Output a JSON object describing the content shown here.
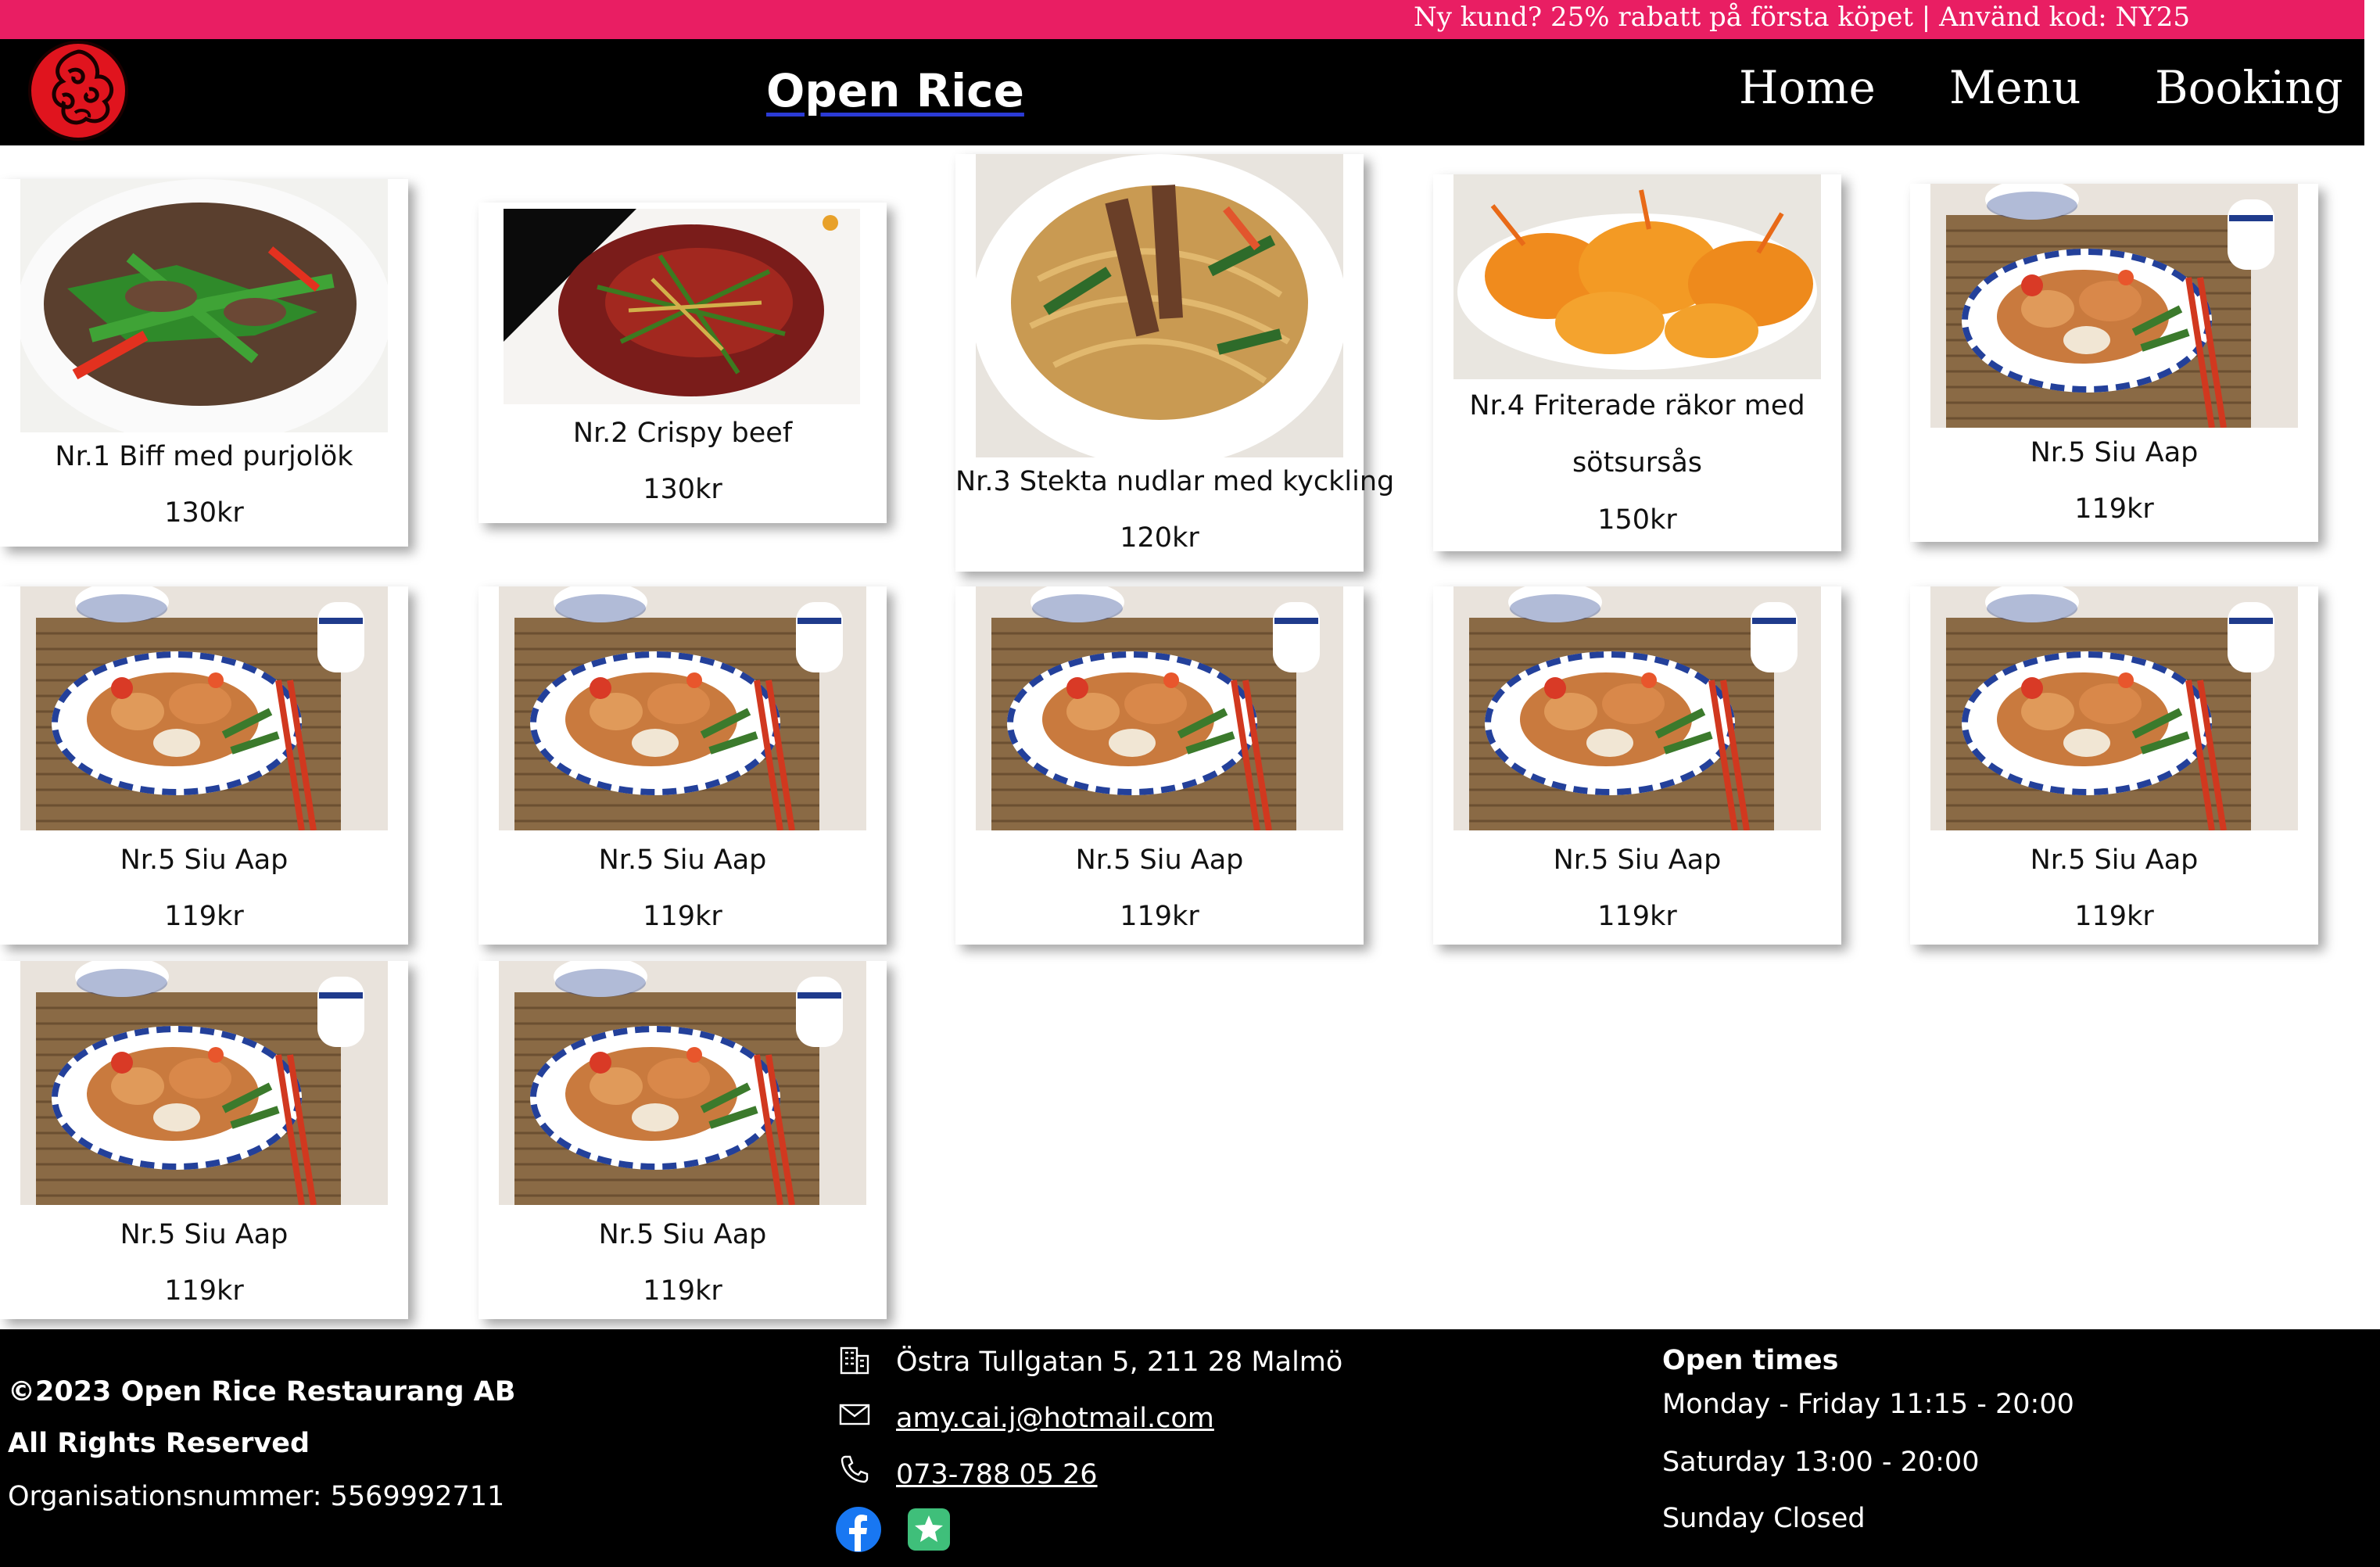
{
  "promo": {
    "text": "Ny kund? 25% rabatt på första köpet | Använd kod: NY25"
  },
  "header": {
    "brand": "Open Rice",
    "nav": [
      "Home",
      "Menu",
      "Booking"
    ]
  },
  "menu": {
    "items": [
      {
        "name": "Nr.1 Biff med purjolök",
        "price": "130kr",
        "image": "beef-leek-dish"
      },
      {
        "name": "Nr.2 Crispy beef",
        "price": "130kr",
        "image": "crispy-beef-dish"
      },
      {
        "name": "Nr.3 Stekta nudlar med kyckling",
        "price": "120kr",
        "image": "fried-noodles-chicken-dish"
      },
      {
        "name_line1": "Nr.4 Friterade räkor med",
        "name_line2": "sötsursås",
        "price": "150kr",
        "image": "fried-shrimp-dish"
      },
      {
        "name": "Nr.5 Siu Aap",
        "price": "119kr",
        "image": "siu-aap-plate"
      },
      {
        "name": "Nr.5 Siu Aap",
        "price": "119kr",
        "image": "siu-aap-plate"
      },
      {
        "name": "Nr.5 Siu Aap",
        "price": "119kr",
        "image": "siu-aap-plate"
      },
      {
        "name": "Nr.5 Siu Aap",
        "price": "119kr",
        "image": "siu-aap-plate"
      },
      {
        "name": "Nr.5 Siu Aap",
        "price": "119kr",
        "image": "siu-aap-plate"
      },
      {
        "name": "Nr.5 Siu Aap",
        "price": "119kr",
        "image": "siu-aap-plate"
      },
      {
        "name": "Nr.5 Siu Aap",
        "price": "119kr",
        "image": "siu-aap-plate"
      },
      {
        "name": "Nr.5 Siu Aap",
        "price": "119kr",
        "image": "siu-aap-plate"
      }
    ]
  },
  "footer": {
    "copyright": "©2023 Open Rice Restaurang AB",
    "rights": "All Rights Reserved",
    "org": "Organisationsnummer: 5569992711",
    "address": "Östra Tullgatan 5, 211 28 Malmö",
    "email": "amy.cai.j@hotmail.com",
    "phone": "073-788 05 26",
    "hours_title": "Open times",
    "hours": [
      "Monday - Friday 11:15 - 20:00",
      "Saturday 13:00 - 20:00",
      "Sunday Closed"
    ],
    "icons": [
      "building-icon",
      "mail-icon",
      "phone-icon",
      "facebook-icon",
      "review-star-icon"
    ]
  },
  "colors": {
    "promo": "#e91e63",
    "header": "#000000",
    "footer": "#000000",
    "brand_underline": "#2b3bd6"
  }
}
